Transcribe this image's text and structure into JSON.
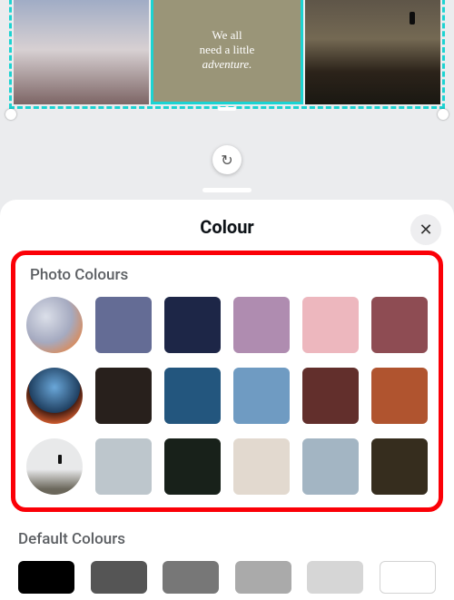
{
  "canvas": {
    "quote_line1": "We all",
    "quote_line2": "need a little",
    "quote_line3_italic": "adventure."
  },
  "sheet": {
    "title": "Colour",
    "close_glyph": "✕",
    "rotate_glyph": "↻"
  },
  "photo_section": {
    "label": "Photo Colours",
    "rows": [
      [
        {
          "kind": "thumb",
          "id": "photo-1"
        },
        {
          "kind": "swatch",
          "hex": "#646c95"
        },
        {
          "kind": "swatch",
          "hex": "#1d2647"
        },
        {
          "kind": "swatch",
          "hex": "#af8cb0"
        },
        {
          "kind": "swatch",
          "hex": "#edb7be"
        },
        {
          "kind": "swatch",
          "hex": "#8e4c53"
        }
      ],
      [
        {
          "kind": "thumb",
          "id": "photo-2"
        },
        {
          "kind": "swatch",
          "hex": "#28201c"
        },
        {
          "kind": "swatch",
          "hex": "#23567e"
        },
        {
          "kind": "swatch",
          "hex": "#6f9bc2"
        },
        {
          "kind": "swatch",
          "hex": "#622f2c"
        },
        {
          "kind": "swatch",
          "hex": "#b0542f"
        }
      ],
      [
        {
          "kind": "thumb",
          "id": "photo-3"
        },
        {
          "kind": "swatch",
          "hex": "#bdc6cc"
        },
        {
          "kind": "swatch",
          "hex": "#18211a"
        },
        {
          "kind": "swatch",
          "hex": "#e2d9cf"
        },
        {
          "kind": "swatch",
          "hex": "#a3b5c3"
        },
        {
          "kind": "swatch",
          "hex": "#362d1e"
        }
      ]
    ]
  },
  "default_section": {
    "label": "Default Colours",
    "row": [
      {
        "hex": "#000000"
      },
      {
        "hex": "#555555"
      },
      {
        "hex": "#777777"
      },
      {
        "hex": "#aaaaaa"
      },
      {
        "hex": "#d6d6d6"
      },
      {
        "hex": "#ffffff",
        "white": true
      }
    ]
  }
}
